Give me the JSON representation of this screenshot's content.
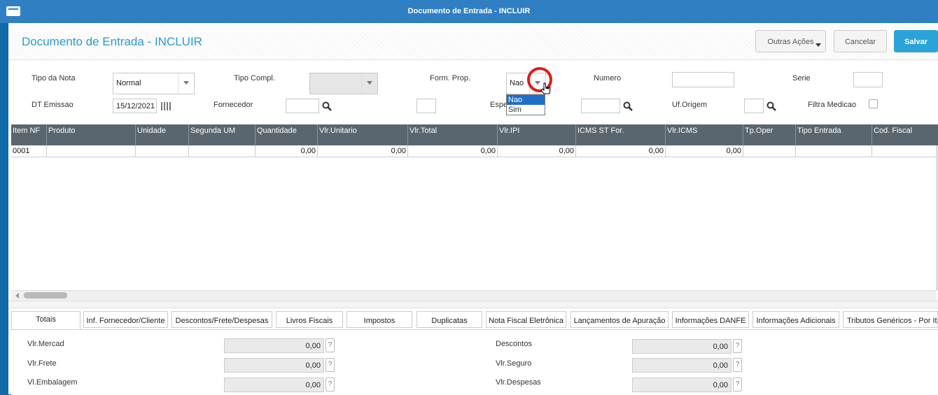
{
  "window": {
    "title": "Documento de Entrada - INCLUIR"
  },
  "header": {
    "title": "Documento de Entrada - INCLUIR",
    "actions": {
      "outras": "Outras Ações",
      "cancel": "Cancelar",
      "save": "Salvar"
    }
  },
  "form": {
    "tipo_nota": {
      "label": "Tipo da Nota",
      "value": "Normal"
    },
    "tipo_compl": {
      "label": "Tipo Compl.",
      "value": ""
    },
    "form_prop": {
      "label": "Form. Prop.",
      "value": "Nao",
      "options": [
        "Nao",
        "Sim"
      ]
    },
    "numero": {
      "label": "Numero",
      "value": ""
    },
    "serie": {
      "label": "Serie",
      "value": ""
    },
    "dt_emissao": {
      "label": "DT Emissao",
      "value": "15/12/2021"
    },
    "fornecedor": {
      "label": "Fornecedor",
      "value": ""
    },
    "espe": {
      "label": "Espe",
      "value": ""
    },
    "uf_origem": {
      "label": "Uf.Origem",
      "value": ""
    },
    "filtra_medicao": {
      "label": "Filtra Medicao",
      "checked": false
    }
  },
  "grid": {
    "columns": [
      "Item NF",
      "Produto",
      "Unidade",
      "Segunda UM",
      "Quantidade",
      "Vlr.Unitario",
      "Vlr.Total",
      "Vlr.IPI",
      "ICMS ST For.",
      "Vlr.ICMS",
      "Tp.Oper",
      "Tipo Entrada",
      "Cod. Fiscal"
    ],
    "rows": [
      [
        "0001",
        "",
        "",
        "",
        "0,00",
        "0,00",
        "0,00",
        "0,00",
        "0,00",
        "0,00",
        "",
        "",
        ""
      ]
    ]
  },
  "tabs": [
    "Totais",
    "Inf. Fornecedor/Cliente",
    "Descontos/Frete/Despesas",
    "Livros Fiscais",
    "Impostos",
    "Duplicatas",
    "Nota Fiscal Eletrônica",
    "Lançamentos de Apuração",
    "Informações DANFE",
    "Informações Adicionais",
    "Tributos Genéricos - Por Ite"
  ],
  "totais": {
    "vlr_mercad": {
      "label": "Vlr.Mercad",
      "value": "0,00"
    },
    "vlr_frete": {
      "label": "Vlr.Frete",
      "value": "0,00"
    },
    "vl_embalagem": {
      "label": "Vl.Embalagem",
      "value": "0,00"
    },
    "descontos": {
      "label": "Descontos",
      "value": "0,00"
    },
    "vlr_seguro": {
      "label": "Vlr.Seguro",
      "value": "0,00"
    },
    "vlr_despesas": {
      "label": "Vlr.Despesas",
      "value": "0,00"
    },
    "help": "?"
  },
  "colors": {
    "accent": "#2ba3d9",
    "title": "#2b9ad0",
    "grid_header": "#5a666f",
    "highlight": "#e01a1a"
  }
}
